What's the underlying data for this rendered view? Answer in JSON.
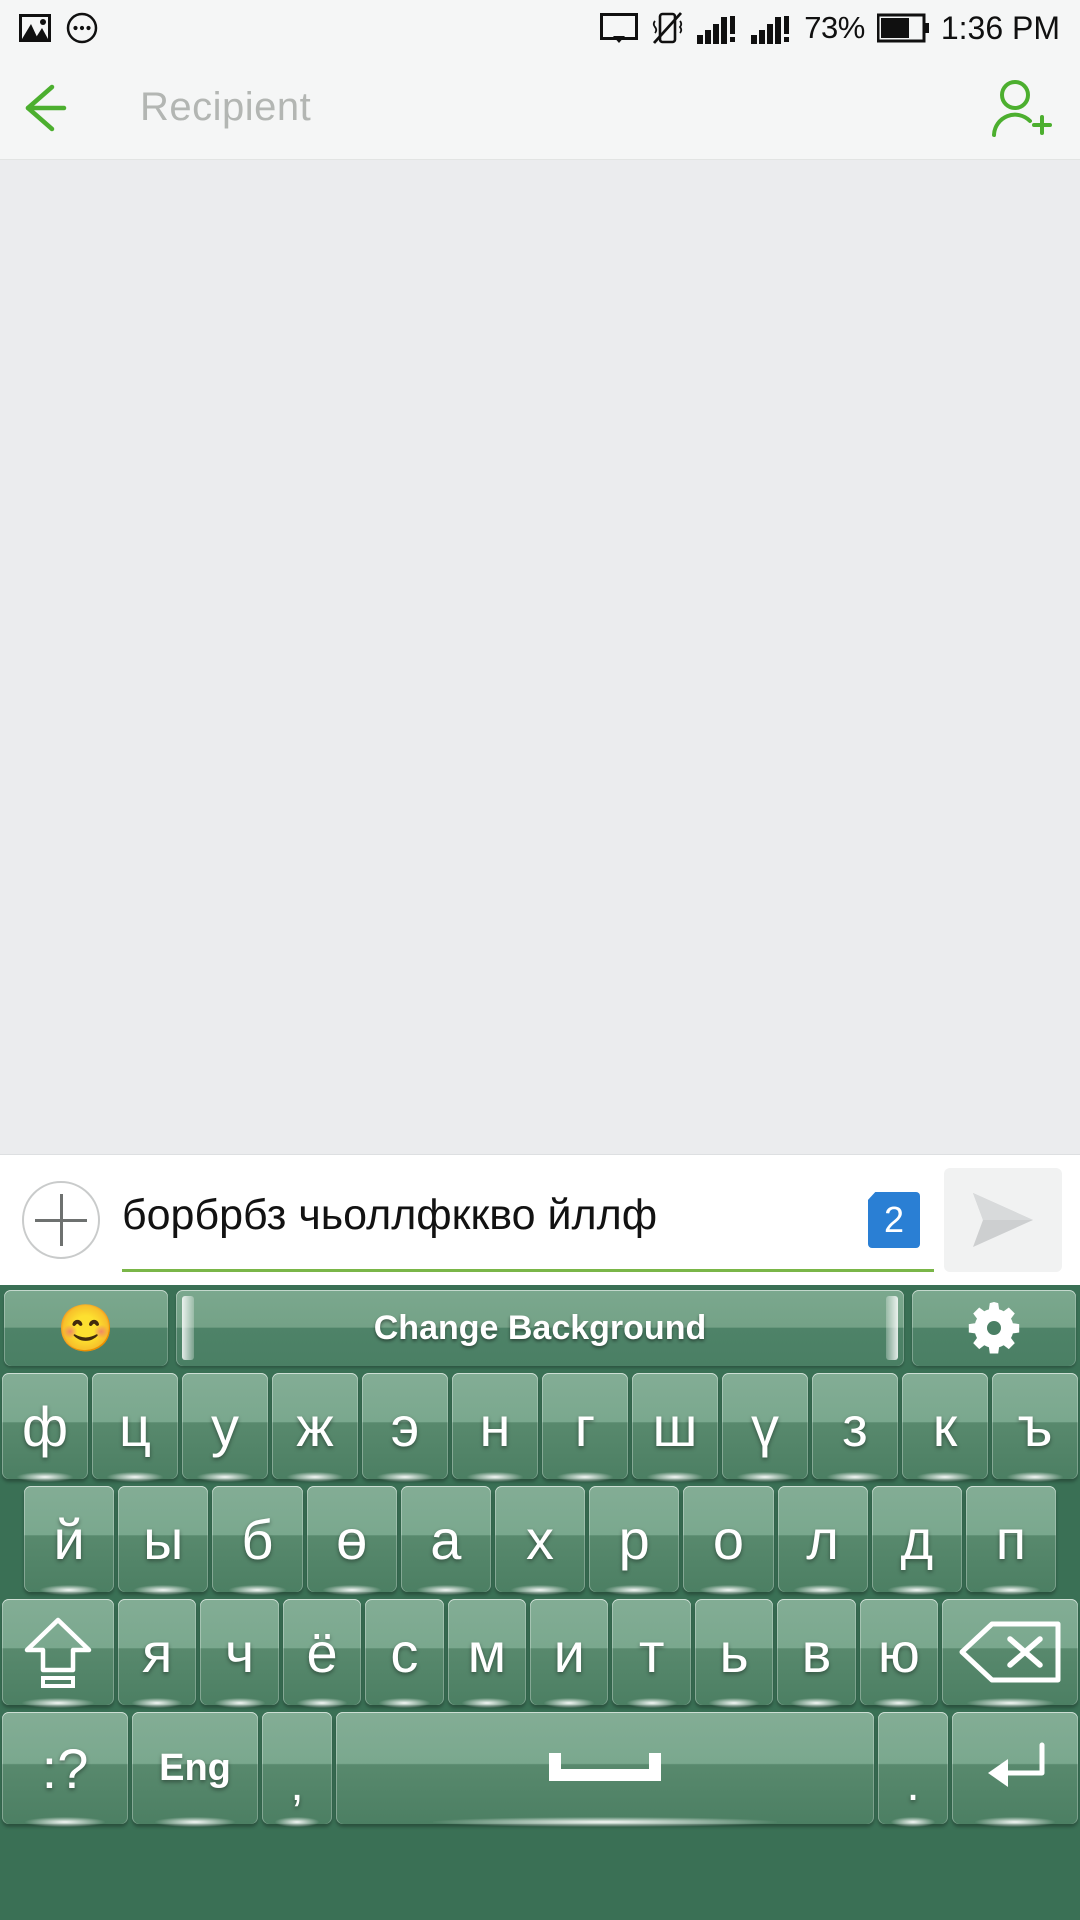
{
  "statusbar": {
    "left_icons": [
      "image-icon",
      "more-circle-icon"
    ],
    "right_icons": [
      "cast-screen-icon",
      "vibrate-off-icon",
      "signal-sim1-icon",
      "signal-sim2-icon"
    ],
    "battery_percent": "73%",
    "battery_icon": "battery-icon",
    "clock": "1:36 PM"
  },
  "header": {
    "back_icon": "back-arrow-icon",
    "title": "Recipient",
    "add_contact_icon": "add-person-icon",
    "accent_color": "#4caf2f",
    "title_color": "#b3b6b3"
  },
  "conversation": {
    "background_color": "#ebecee",
    "messages": []
  },
  "compose": {
    "attach_icon": "plus-icon",
    "input_value": "борбрбз чьоллфккво йллф",
    "input_placeholder": "",
    "underline_color": "#7ab648",
    "sim_badge": "2",
    "sim_badge_color": "#2a7fd4",
    "send_icon": "send-arrow-icon",
    "send_enabled": false
  },
  "keyboard": {
    "background_color": "#3a7055",
    "key_color": "#7aa88e",
    "toolbar": {
      "emoji_label": "😊",
      "emoji_name": "emoji-button",
      "change_background_label": "Change Background",
      "settings_icon": "gear-icon"
    },
    "rows": [
      {
        "name": "row-1",
        "keys": [
          {
            "label": "ф",
            "type": "letter"
          },
          {
            "label": "ц",
            "type": "letter"
          },
          {
            "label": "у",
            "type": "letter"
          },
          {
            "label": "ж",
            "type": "letter"
          },
          {
            "label": "э",
            "type": "letter"
          },
          {
            "label": "н",
            "type": "letter"
          },
          {
            "label": "г",
            "type": "letter"
          },
          {
            "label": "ш",
            "type": "letter"
          },
          {
            "label": "ү",
            "type": "letter"
          },
          {
            "label": "з",
            "type": "letter"
          },
          {
            "label": "к",
            "type": "letter"
          },
          {
            "label": "ъ",
            "type": "letter"
          }
        ]
      },
      {
        "name": "row-2",
        "keys": [
          {
            "label": "й",
            "type": "letter"
          },
          {
            "label": "ы",
            "type": "letter"
          },
          {
            "label": "б",
            "type": "letter"
          },
          {
            "label": "ө",
            "type": "letter"
          },
          {
            "label": "а",
            "type": "letter"
          },
          {
            "label": "х",
            "type": "letter"
          },
          {
            "label": "р",
            "type": "letter"
          },
          {
            "label": "о",
            "type": "letter"
          },
          {
            "label": "л",
            "type": "letter"
          },
          {
            "label": "д",
            "type": "letter"
          },
          {
            "label": "п",
            "type": "letter"
          }
        ]
      },
      {
        "name": "row-3",
        "keys": [
          {
            "label": "",
            "type": "shift",
            "icon": "shift-arrow-icon"
          },
          {
            "label": "я",
            "type": "letter"
          },
          {
            "label": "ч",
            "type": "letter"
          },
          {
            "label": "ё",
            "type": "letter"
          },
          {
            "label": "с",
            "type": "letter"
          },
          {
            "label": "м",
            "type": "letter"
          },
          {
            "label": "и",
            "type": "letter"
          },
          {
            "label": "т",
            "type": "letter"
          },
          {
            "label": "ь",
            "type": "letter"
          },
          {
            "label": "в",
            "type": "letter"
          },
          {
            "label": "ю",
            "type": "letter"
          },
          {
            "label": "",
            "type": "backspace",
            "icon": "backspace-icon"
          }
        ]
      },
      {
        "name": "row-4",
        "keys": [
          {
            "label": ":?",
            "type": "symbols"
          },
          {
            "label": "Eng",
            "type": "language"
          },
          {
            "label": ",",
            "type": "comma"
          },
          {
            "label": "",
            "type": "space",
            "icon": "spacebar-icon"
          },
          {
            "label": ".",
            "type": "period"
          },
          {
            "label": "",
            "type": "enter",
            "icon": "enter-icon"
          }
        ]
      }
    ]
  }
}
